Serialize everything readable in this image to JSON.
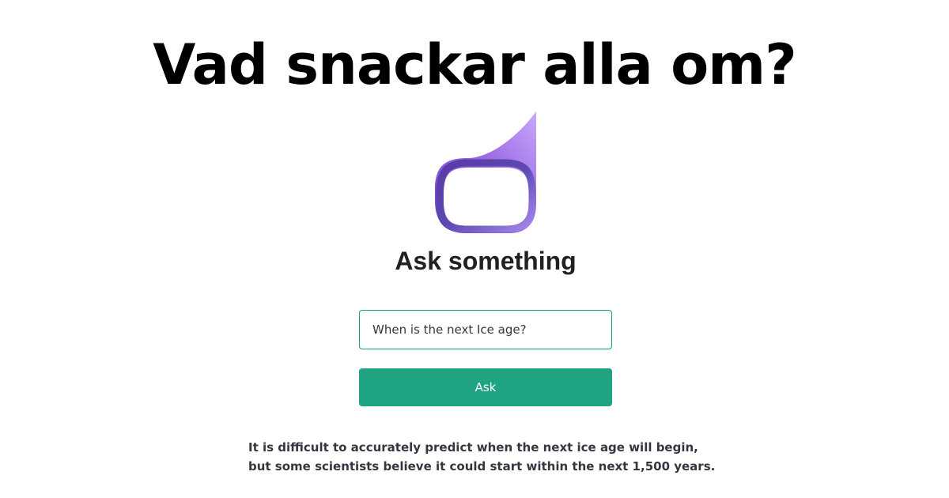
{
  "headline": "Vad snackar alla om?",
  "logo": {
    "icon": "speech-bubble-icon",
    "gradient_colors": [
      "#5a46b4",
      "#8e55d6",
      "#bfa3f5"
    ]
  },
  "ask": {
    "title": "Ask something",
    "input_value": "When is the next Ice age?",
    "button_label": "Ask"
  },
  "answer": {
    "text": "It is difficult to accurately predict when the next ice age will begin, but some scientists believe it could start within the next 1,500 years."
  },
  "colors": {
    "accent": "#1fa382",
    "input_border": "#10a37f",
    "answer_text": "#353740"
  }
}
